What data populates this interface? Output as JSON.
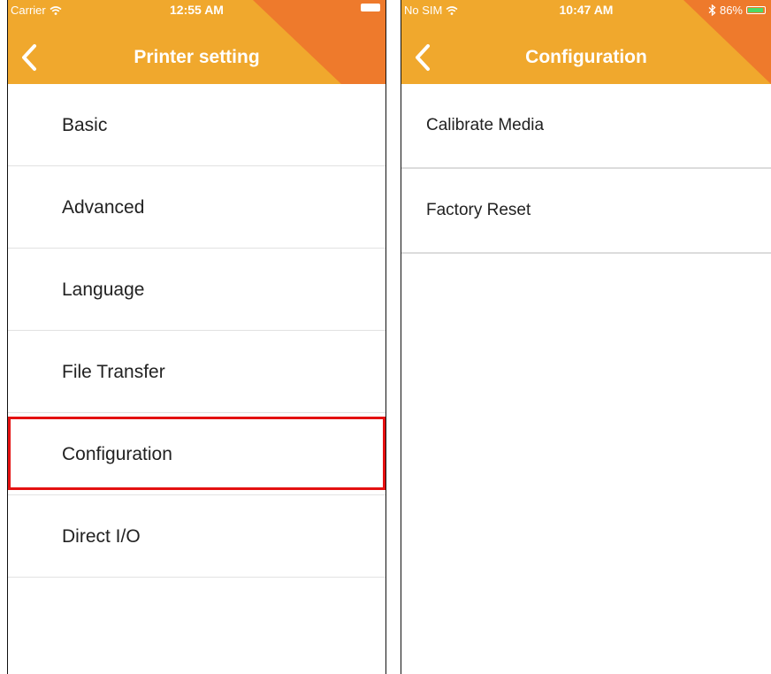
{
  "left_screen": {
    "status": {
      "carrier": "Carrier",
      "time": "12:55 AM"
    },
    "nav": {
      "title": "Printer setting"
    },
    "items": [
      {
        "label": "Basic"
      },
      {
        "label": "Advanced"
      },
      {
        "label": "Language"
      },
      {
        "label": "File Transfer"
      },
      {
        "label": "Configuration",
        "highlighted": true
      },
      {
        "label": "Direct I/O"
      }
    ]
  },
  "right_screen": {
    "status": {
      "carrier": "No SIM",
      "time": "10:47 AM",
      "battery": "86%"
    },
    "nav": {
      "title": "Configuration"
    },
    "items": [
      {
        "label": "Calibrate Media"
      },
      {
        "label": "Factory Reset"
      }
    ]
  },
  "colors": {
    "header_orange": "#f0a82d",
    "header_dark_orange": "#ee7a2c",
    "highlight_red": "#e41111",
    "battery_green": "#4cd964"
  },
  "icons": [
    "wifi-icon",
    "battery-icon",
    "bluetooth-icon",
    "back-chevron-icon"
  ]
}
